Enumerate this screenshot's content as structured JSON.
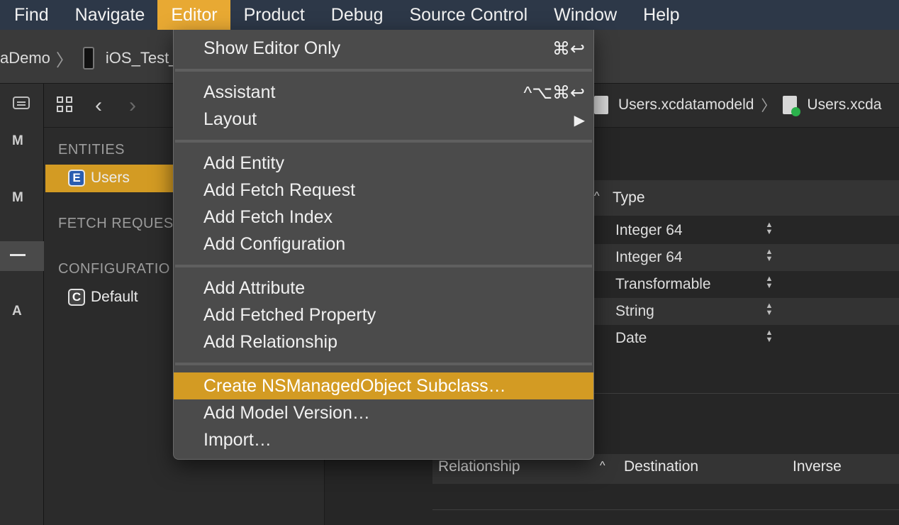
{
  "menubar": [
    "Find",
    "Navigate",
    "Editor",
    "Product",
    "Debug",
    "Source Control",
    "Window",
    "Help"
  ],
  "active_menu": "Editor",
  "toolbar": {
    "scheme": "aDemo",
    "device": "iOS_Test_iP"
  },
  "breadcrumbs": [
    "Users.xcdatamodeld",
    "Users.xcda"
  ],
  "sidebar": {
    "entities_header": "ENTITIES",
    "entity": {
      "badge": "E",
      "label": "Users"
    },
    "fetch_header": "FETCH REQUES",
    "config_header": "CONFIGURATIO",
    "config": {
      "badge": "C",
      "label": "Default"
    }
  },
  "slim_letters": [
    "M",
    "M",
    "A"
  ],
  "attributes": {
    "type_header": "Type",
    "sort_glyph": "^",
    "types": [
      "Integer 64",
      "Integer 64",
      "Transformable",
      "String",
      "Date"
    ]
  },
  "relationships": {
    "col1": "Relationship",
    "col2": "Destination",
    "col3": "Inverse",
    "sort_glyph": "^"
  },
  "menu": {
    "items": [
      {
        "label": "Show Editor Only",
        "shortcut": "⌘↩"
      },
      {
        "label": "Assistant",
        "shortcut": "^⌥⌘↩"
      },
      {
        "label": "Layout",
        "shortcut": "▶"
      },
      {
        "label": "Add Entity",
        "shortcut": ""
      },
      {
        "label": "Add Fetch Request",
        "shortcut": ""
      },
      {
        "label": "Add Fetch Index",
        "shortcut": ""
      },
      {
        "label": "Add Configuration",
        "shortcut": ""
      },
      {
        "label": "Add Attribute",
        "shortcut": ""
      },
      {
        "label": "Add Fetched Property",
        "shortcut": ""
      },
      {
        "label": "Add Relationship",
        "shortcut": ""
      },
      {
        "label": "Create NSManagedObject Subclass…",
        "shortcut": ""
      },
      {
        "label": "Add Model Version…",
        "shortcut": ""
      },
      {
        "label": "Import…",
        "shortcut": ""
      }
    ],
    "highlighted": "Create NSManagedObject Subclass…"
  }
}
